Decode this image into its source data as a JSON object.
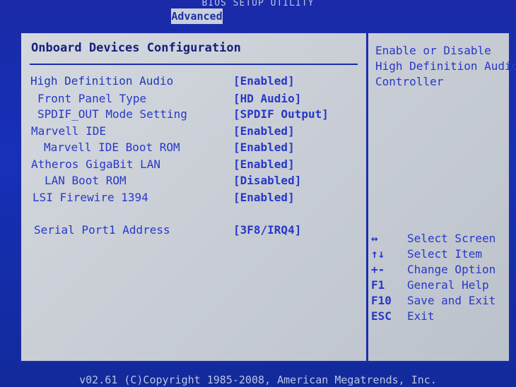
{
  "header": {
    "title": "BIOS SETUP UTILITY",
    "active_tab": "Advanced"
  },
  "section": {
    "title": "Onboard Devices Configuration"
  },
  "settings": [
    {
      "label": "High Definition Audio",
      "value": "[Enabled]"
    },
    {
      "label": "Front Panel Type",
      "value": "[HD Audio]"
    },
    {
      "label": "SPDIF_OUT Mode Setting",
      "value": "[SPDIF Output]"
    },
    {
      "label": "Marvell IDE",
      "value": "[Enabled]"
    },
    {
      "label": "Marvell IDE Boot ROM",
      "value": "[Enabled]"
    },
    {
      "label": "Atheros GigaBit LAN",
      "value": "[Enabled]"
    },
    {
      "label": "LAN Boot ROM",
      "value": "[Disabled]"
    },
    {
      "label": "LSI Firewire 1394",
      "value": "[Enabled]"
    },
    {
      "label": "Serial Port1 Address",
      "value": "[3F8/IRQ4]"
    }
  ],
  "help": {
    "lines": [
      "Enable or Disable",
      "High Definition Audio",
      "Controller"
    ]
  },
  "keys": [
    {
      "key": "↔",
      "desc": "Select Screen"
    },
    {
      "key": "↑↓",
      "desc": "Select Item"
    },
    {
      "key": "+-",
      "desc": "Change Option"
    },
    {
      "key": "F1",
      "desc": "General Help"
    },
    {
      "key": "F10",
      "desc": "Save and Exit"
    },
    {
      "key": "ESC",
      "desc": "Exit"
    }
  ],
  "footer": {
    "text": "v02.61 (C)Copyright 1985-2008, American Megatrends, Inc."
  }
}
